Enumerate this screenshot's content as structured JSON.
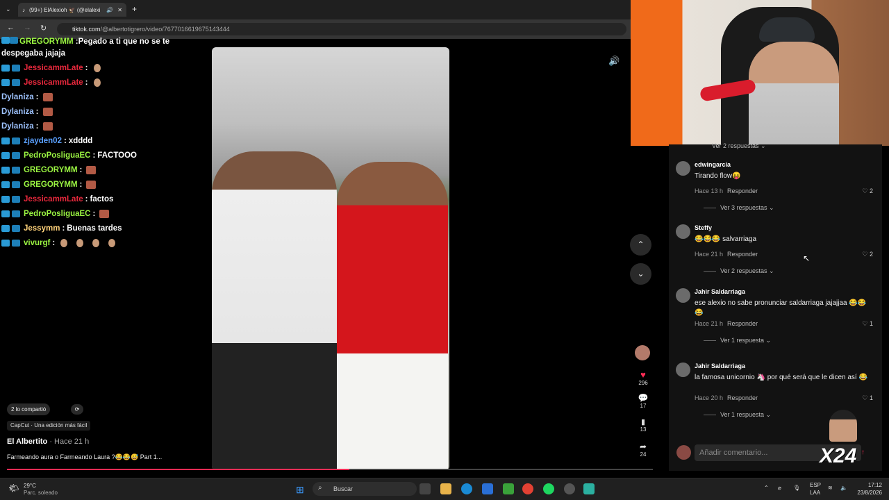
{
  "browser": {
    "tab_title": "(99+) ElAlexioh 🦅 (@elalexi",
    "url_host": "tiktok.com",
    "url_path": "/@albertotigrero/video/7677016619675143444"
  },
  "chat": [
    {
      "user": "GREGORYMM",
      "color": "#9bf542",
      "msg": "Pegado a ti que no se te despegaba jajaja",
      "emotes": 0
    },
    {
      "user": "JessicammLate",
      "color": "#e8283c",
      "msg": "",
      "emotes": 1
    },
    {
      "user": "JessicammLate",
      "color": "#e8283c",
      "msg": "",
      "emotes": 1
    },
    {
      "user": "Dylaniza",
      "color": "#9fc4ff",
      "msg": "",
      "emotes": 1
    },
    {
      "user": "Dylaniza",
      "color": "#9fc4ff",
      "msg": "",
      "emotes": 1
    },
    {
      "user": "Dylaniza",
      "color": "#9fc4ff",
      "msg": "",
      "emotes": 1
    },
    {
      "user": "zjayden02",
      "color": "#5aa0ff",
      "msg": "xdddd",
      "emotes": 0
    },
    {
      "user": "PedroPosliguaEC",
      "color": "#9bf542",
      "msg": "FACTOOO",
      "emotes": 0
    },
    {
      "user": "GREGORYMM",
      "color": "#9bf542",
      "msg": "",
      "emotes": 1
    },
    {
      "user": "GREGORYMM",
      "color": "#9bf542",
      "msg": "",
      "emotes": 1
    },
    {
      "user": "JessicammLate",
      "color": "#e8283c",
      "msg": "factos",
      "emotes": 0
    },
    {
      "user": "PedroPosliguaEC",
      "color": "#9bf542",
      "msg": "",
      "emotes": 1
    },
    {
      "user": "Jessymm",
      "color": "#ffd27a",
      "msg": "Buenas tardes",
      "emotes": 0
    },
    {
      "user": "vivurgf",
      "color": "#9bf542",
      "msg": "",
      "emotes": 4
    }
  ],
  "video": {
    "shared_label": "2 lo compartió",
    "capcut_label": "CapCut · Una edición más fácil",
    "author": "El Albertito",
    "time": "· Hace 21 h",
    "caption": "Farmeando aura o Farmeando Laura ?😂😂😅 Part 1...",
    "progress": 0.53
  },
  "actions": {
    "likes": "296",
    "comments": "17",
    "saves": "13",
    "shares": "24"
  },
  "comments": {
    "top_more": "Ver 2 respuestas",
    "items": [
      {
        "user": "edwingarcia",
        "text": "Tirando flow😝",
        "time": "Hace 13 h",
        "reply": "Responder",
        "likes": "2",
        "more": "Ver 3 respuestas"
      },
      {
        "user": "Steffy",
        "text": "😂😂😂 salvarriaga",
        "time": "Hace 21 h",
        "reply": "Responder",
        "likes": "2",
        "more": "Ver 2 respuestas"
      },
      {
        "user": "Jahir Saldarriaga",
        "text": "ese alexio no sabe pronunciar saldarriaga jajajjaa 😂😂😂",
        "time": "Hace 21 h",
        "reply": "Responder",
        "likes": "1",
        "more": "Ver 1 respuesta"
      },
      {
        "user": "Jahir Saldarriaga",
        "text": "la famosa unicornio 🦄 por qué será que le dicen así 😂",
        "time": "Hace 20 h",
        "reply": "Responder",
        "likes": "1",
        "more": "Ver 1 respuesta"
      }
    ],
    "add_placeholder": "Añadir comentario..."
  },
  "overlay": {
    "counter": "X24"
  },
  "taskbar": {
    "temp": "29°C",
    "weather": "Parc. soleado",
    "search": "Buscar",
    "lang1": "ESP",
    "lang2": "LAA",
    "clock": "17:12",
    "date": "23/8/2026"
  }
}
